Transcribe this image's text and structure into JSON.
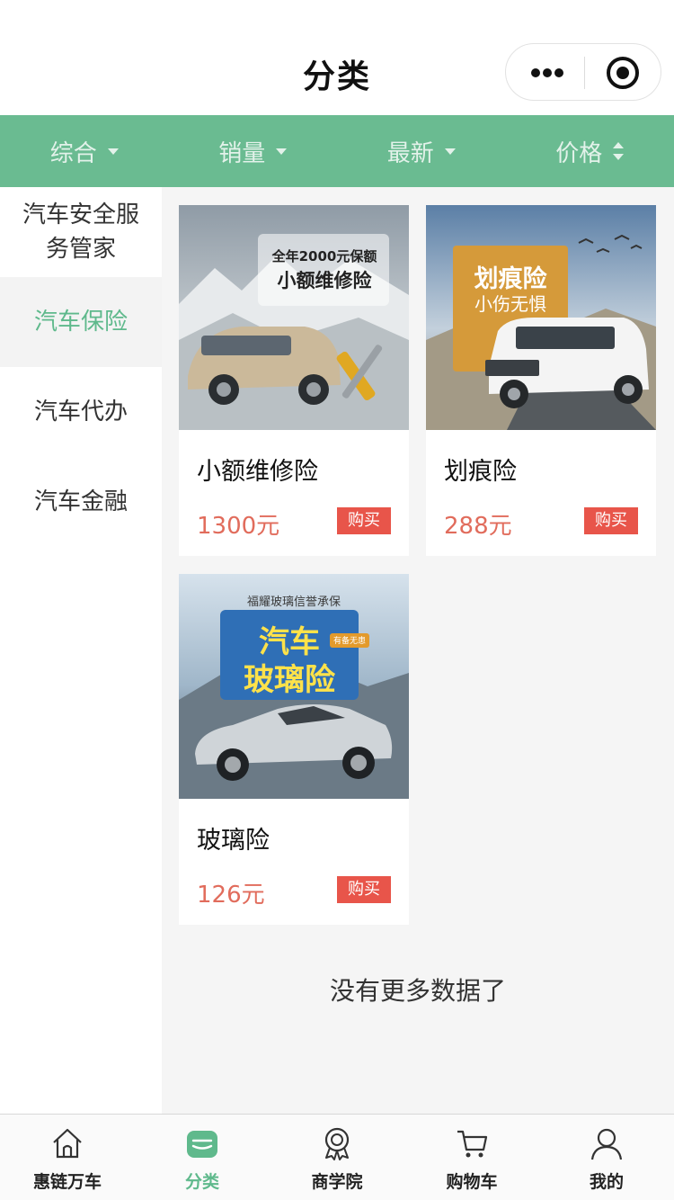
{
  "header": {
    "title": "分类"
  },
  "filters": [
    {
      "label": "综合",
      "indicator": "dropdown"
    },
    {
      "label": "销量",
      "indicator": "dropdown"
    },
    {
      "label": "最新",
      "indicator": "dropdown"
    },
    {
      "label": "价格",
      "indicator": "sort"
    }
  ],
  "sidebar": {
    "items": [
      {
        "label": "汽车安全服务管家",
        "active": false
      },
      {
        "label": "汽车保险",
        "active": true
      },
      {
        "label": "汽车代办",
        "active": false
      },
      {
        "label": "汽车金融",
        "active": false
      }
    ]
  },
  "products": [
    {
      "name": "小额维修险",
      "price": "1300元",
      "buy_label": "购买",
      "image_text_line1": "全年2000元保额",
      "image_text_line2": "小额维修险"
    },
    {
      "name": "划痕险",
      "price": "288元",
      "buy_label": "购买",
      "image_text_line1": "划痕险",
      "image_text_line2": "小伤无惧"
    },
    {
      "name": "玻璃险",
      "price": "126元",
      "buy_label": "购买",
      "image_text_top": "福耀玻璃信誉承保",
      "image_text_line1": "汽车",
      "image_text_line2": "玻璃险",
      "image_badge": "有备无患"
    }
  ],
  "no_more_text": "没有更多数据了",
  "tabbar": {
    "items": [
      {
        "label": "惠链万车",
        "icon": "home-icon",
        "active": false
      },
      {
        "label": "分类",
        "icon": "category-icon",
        "active": true
      },
      {
        "label": "商学院",
        "icon": "award-icon",
        "active": false
      },
      {
        "label": "购物车",
        "icon": "cart-icon",
        "active": false
      },
      {
        "label": "我的",
        "icon": "user-icon",
        "active": false
      }
    ]
  },
  "colors": {
    "accent": "#5fb98c",
    "filter_bar": "#6abb91",
    "price": "#e16c5c",
    "buy_button": "#e8554a"
  }
}
